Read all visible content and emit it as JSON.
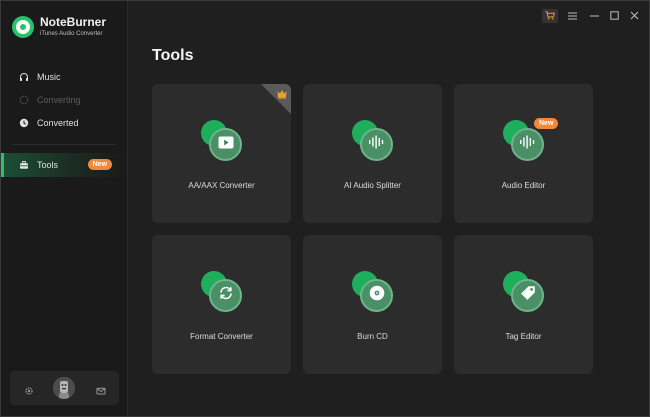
{
  "app": {
    "name": "NoteBurner",
    "subtitle": "iTunes Audio Converter"
  },
  "sidebar": {
    "items": [
      {
        "label": "Music",
        "icon": "headphones-icon",
        "state": "normal"
      },
      {
        "label": "Converting",
        "icon": "converting-icon",
        "state": "disabled"
      },
      {
        "label": "Converted",
        "icon": "clock-icon",
        "state": "normal"
      }
    ],
    "tools_item": {
      "label": "Tools",
      "icon": "toolbox-icon",
      "badge": "New",
      "state": "active"
    }
  },
  "main": {
    "title": "Tools",
    "tools": [
      {
        "label": "AA/AAX Converter",
        "icon": "play-icon"
      },
      {
        "label": "AI Audio Splitter",
        "icon": "waveform-icon"
      },
      {
        "label": "Audio Editor",
        "icon": "waveform-icon",
        "badge": "New"
      },
      {
        "label": "Format Converter",
        "icon": "refresh-icon"
      },
      {
        "label": "Burn CD",
        "icon": "disc-icon"
      },
      {
        "label": "Tag Editor",
        "icon": "tag-icon"
      }
    ]
  },
  "colors": {
    "accent": "#27c26a",
    "badge": "#f08a3a",
    "card": "#2c2c2c",
    "background": "#1f1f1f",
    "cart": "#f0a030"
  }
}
